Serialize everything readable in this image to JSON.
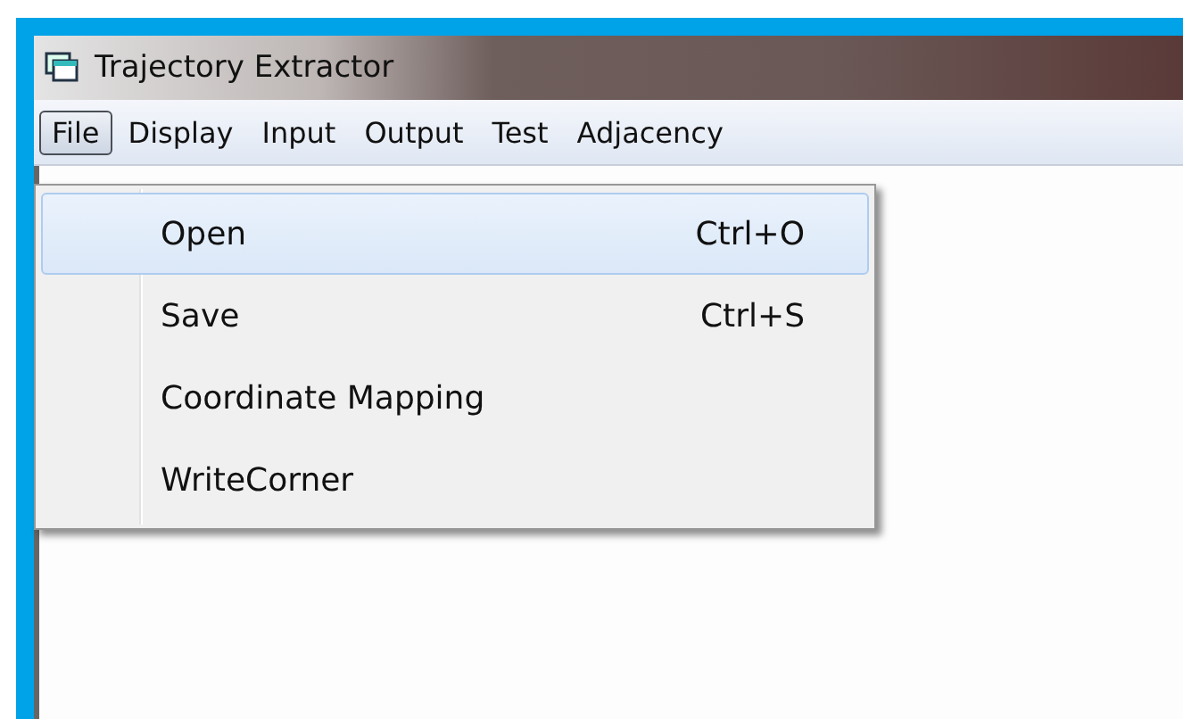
{
  "window": {
    "title": "Trajectory Extractor"
  },
  "menu_bar": [
    {
      "label": "File",
      "selected": true
    },
    {
      "label": "Display",
      "selected": false
    },
    {
      "label": "Input",
      "selected": false
    },
    {
      "label": "Output",
      "selected": false
    },
    {
      "label": "Test",
      "selected": false
    },
    {
      "label": "Adjacency",
      "selected": false
    }
  ],
  "file_menu": [
    {
      "label": "Open",
      "shortcut": "Ctrl+O",
      "selected": true
    },
    {
      "label": "Save",
      "shortcut": "Ctrl+S",
      "selected": false
    },
    {
      "label": "Coordinate Mapping",
      "selected": false
    },
    {
      "label": "WriteCorner",
      "selected": false
    }
  ]
}
